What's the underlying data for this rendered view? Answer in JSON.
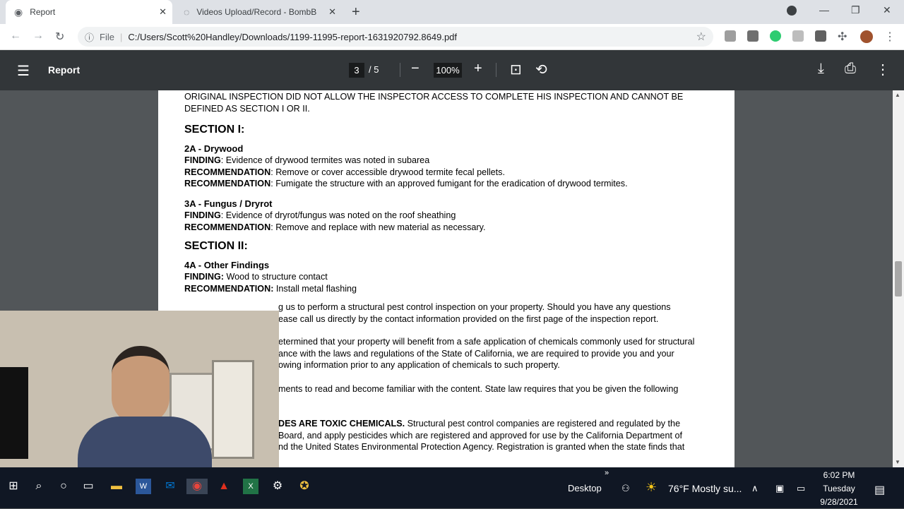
{
  "browser": {
    "tabs": [
      {
        "title": "Report",
        "active": true
      },
      {
        "title": "Videos Upload/Record - BombBo",
        "active": false
      }
    ],
    "url_prefix": "File",
    "url": "C:/Users/Scott%20Handley/Downloads/1199-11995-report-1631920792.8649.pdf"
  },
  "pdf_toolbar": {
    "title": "Report",
    "current_page": "3",
    "total_pages": "/  5",
    "zoom": "100%"
  },
  "document": {
    "intro": "ORIGINAL INSPECTION DID NOT ALLOW THE INSPECTOR ACCESS TO COMPLETE HIS INSPECTION AND CANNOT BE DEFINED AS SECTION I OR II.",
    "section1_heading": "SECTION I:",
    "item_2a": {
      "title": "2A - Drywood",
      "finding_label": "FINDING",
      "finding": ": Evidence of drywood termites was noted in subarea",
      "rec1_label": "RECOMMENDATION",
      "rec1": ": Remove or cover accessible drywood termite fecal pellets.",
      "rec2_label": "RECOMMENDATION",
      "rec2": ": Fumigate the structure with an approved fumigant for the eradication of drywood termites."
    },
    "item_3a": {
      "title": "3A - Fungus / Dryrot",
      "finding_label": "FINDING",
      "finding": ": Evidence of dryrot/fungus was noted on the roof sheathing",
      "rec_label": "RECOMMENDATION",
      "rec": ": Remove and replace with new material as necessary."
    },
    "section2_heading": "SECTION II:",
    "item_4a": {
      "title": "4A - Other Findings",
      "finding_label": "FINDING:",
      "finding": " Wood to structure contact",
      "rec_label": "RECOMMENDATION:",
      "rec": " Install metal flashing"
    },
    "para1_line1": "g us to perform a structural pest control inspection on your property. Should you have any questions",
    "para1_line2": "ease call us directly by the contact information provided on the first page of the inspection report.",
    "para2_line1": "etermined that your property will benefit from a safe application of chemicals commonly used for structural",
    "para2_line2": "ance with the laws and regulations of the State of California, we are required to provide you and your",
    "para2_line3": "owing information prior to any application of chemicals to such property.",
    "para3_line1": "ments to read and become familiar with the content. State law requires that you be given the following",
    "para4_bold": "DES ARE TOXIC CHEMICALS.",
    "para4_line1": " Structural pest control companies are registered and regulated by the",
    "para4_line2": " Board, and apply pesticides which are registered and approved for use by the California Department of",
    "para4_line3": "nd the United States Environmental Protection Agency. Registration is granted when the state finds that"
  },
  "taskbar": {
    "desktop_label": "Desktop",
    "weather": "76°F  Mostly su...",
    "time": "6:02 PM",
    "day": "Tuesday",
    "date": "9/28/2021"
  },
  "colors": {
    "pdf_toolbar": "#323639",
    "viewer_bg": "#525659",
    "taskbar": "#101724"
  }
}
